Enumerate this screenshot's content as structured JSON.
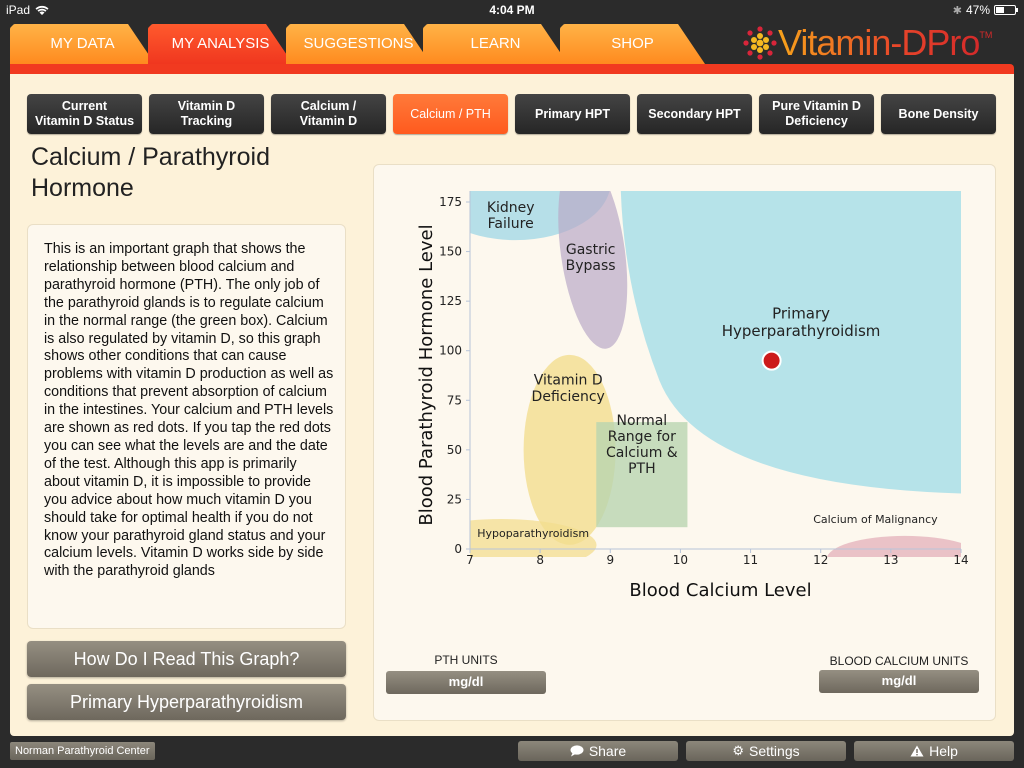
{
  "status_bar": {
    "device": "iPad",
    "time": "4:04 PM",
    "battery": "47%",
    "battery_level": 0.47
  },
  "tabs": [
    {
      "label": "MY DATA",
      "active": false
    },
    {
      "label": "MY ANALYSIS",
      "active": true
    },
    {
      "label": "SUGGESTIONS",
      "active": false
    },
    {
      "label": "LEARN",
      "active": false
    },
    {
      "label": "SHOP",
      "active": false
    }
  ],
  "logo": {
    "text": "Vitamin-DPro",
    "tm": "TM"
  },
  "subtabs": [
    {
      "label": "Current\nVitamin D Status",
      "active": false
    },
    {
      "label": "Vitamin D\nTracking",
      "active": false
    },
    {
      "label": "Calcium /\nVitamin D",
      "active": false
    },
    {
      "label": "Calcium / PTH",
      "active": true
    },
    {
      "label": "Primary HPT",
      "active": false
    },
    {
      "label": "Secondary HPT",
      "active": false
    },
    {
      "label": "Pure Vitamin D\nDeficiency",
      "active": false
    },
    {
      "label": "Bone Density",
      "active": false
    }
  ],
  "page_title": "Calcium / Parathyroid Hormone",
  "description": "This is an important graph that shows the relationship between blood calcium and parathyroid hormone (PTH). The only job of the parathyroid glands is to regulate calcium in the normal range (the green box). Calcium is also regulated by vitamin D, so this graph shows other conditions that can cause problems with vitamin D production as well as conditions that prevent absorption of calcium in the intestines. Your calcium and PTH levels are shown as red dots. If you tap the red dots you can see what the levels are and the date of the test. Although this app is primarily about vitamin D, it is impossible to provide you advice about how much vitamin D you should take for optimal health if you do not know your parathyroid gland status and your calcium levels. Vitamin D works side by side with the parathyroid glands",
  "buttons": {
    "how_to_read": "How Do I Read This Graph?",
    "diagnosis": "Primary Hyperparathyroidism"
  },
  "units": {
    "pth_label": "PTH UNITS",
    "pth_value": "mg/dl",
    "calcium_label": "BLOOD CALCIUM UNITS",
    "calcium_value": "mg/dl"
  },
  "bottom_bar": {
    "npc": "Norman Parathyroid Center",
    "share": "Share",
    "settings": "Settings",
    "help": "Help"
  },
  "colors": {
    "accent_orange": "#ff7a3a",
    "tab_active": "#f0371f",
    "dot": "#cc1a1a"
  },
  "chart_data": {
    "type": "scatter",
    "title": "",
    "xlabel": "Blood Calcium Level",
    "ylabel": "Blood Parathyroid Hormone Level",
    "xlim": [
      7,
      14
    ],
    "ylim": [
      0,
      180
    ],
    "xticks": [
      7,
      8,
      9,
      10,
      11,
      12,
      13,
      14
    ],
    "yticks": [
      0,
      25,
      50,
      75,
      100,
      125,
      150,
      175
    ],
    "regions": [
      {
        "name": "Kidney Failure",
        "label": "Kidney\nFailure",
        "color": "#a9dbe6"
      },
      {
        "name": "Gastric Bypass",
        "label": "Gastric\nBypass",
        "color": "#b9aac8"
      },
      {
        "name": "Primary Hyperparathyroidism",
        "label": "Primary\nHyperparathyroidism",
        "color": "#a9dfe8"
      },
      {
        "name": "Vitamin D Deficiency",
        "label": "Vitamin D\nDeficiency",
        "color": "#f3dd8f"
      },
      {
        "name": "Normal Range for Calcium & PTH",
        "label": "Normal\nRange for\nCalcium &\nPTH",
        "color": "#b9d4b0",
        "x_range": [
          8.8,
          10.1
        ],
        "y_range": [
          11,
          64
        ]
      },
      {
        "name": "Hypoparathyroidism",
        "label": "Hypoparathyroidism",
        "color": "#f3dd8f"
      },
      {
        "name": "Calcium of Malignancy",
        "label": "Calcium of Malignancy",
        "color": "#e6b8c0"
      }
    ],
    "points": [
      {
        "x": 11.3,
        "y": 95
      }
    ]
  }
}
